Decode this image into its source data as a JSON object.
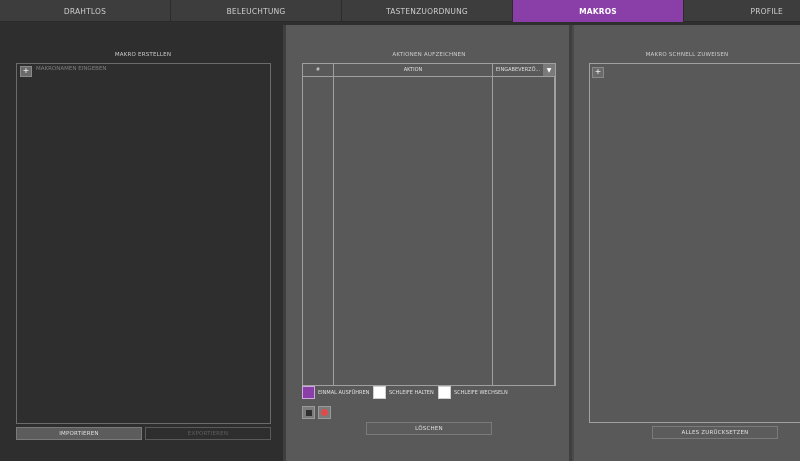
{
  "tabs": [
    {
      "label": "DRAHTLOS",
      "active": false
    },
    {
      "label": "BELEUCHTUNG",
      "active": false
    },
    {
      "label": "TASTENZUORDNUNG",
      "active": false
    },
    {
      "label": "MAKROS",
      "active": true
    },
    {
      "label": "PROFILE",
      "active": false
    }
  ],
  "battery_icon": "battery-charging-icon",
  "panel_create": {
    "title": "MAKRO ERSTELLEN",
    "add_symbol": "+",
    "name_placeholder": "MAKRONAMEN EINGEBEN",
    "import_label": "IMPORTIEREN",
    "export_label": "EXPORTIEREN"
  },
  "panel_record": {
    "title": "AKTIONEN AUFZEICHNEN",
    "columns": [
      "#",
      "AKTION",
      "EINGABEVERZÖ..."
    ],
    "scroll_symbol": "▼",
    "options": [
      {
        "label": "EINMAL AUSFÜHREN",
        "checked": true
      },
      {
        "label": "SCHLEIFE HALTEN",
        "checked": false
      },
      {
        "label": "SCHLEIFE WECHSELN",
        "checked": false
      }
    ],
    "stop_icon": "stop-icon",
    "record_icon": "record-icon",
    "delete_label": "LÖSCHEN"
  },
  "panel_assign": {
    "title": "MAKRO SCHNELL ZUWEISEN",
    "add_symbol": "+",
    "reset_label": "ALLES ZURÜCKSETZEN"
  },
  "colors": {
    "accent": "#8a3fa8",
    "panel_dark": "#2e2e2e",
    "panel_mid": "#595959",
    "record_red": "#e04a4a"
  }
}
